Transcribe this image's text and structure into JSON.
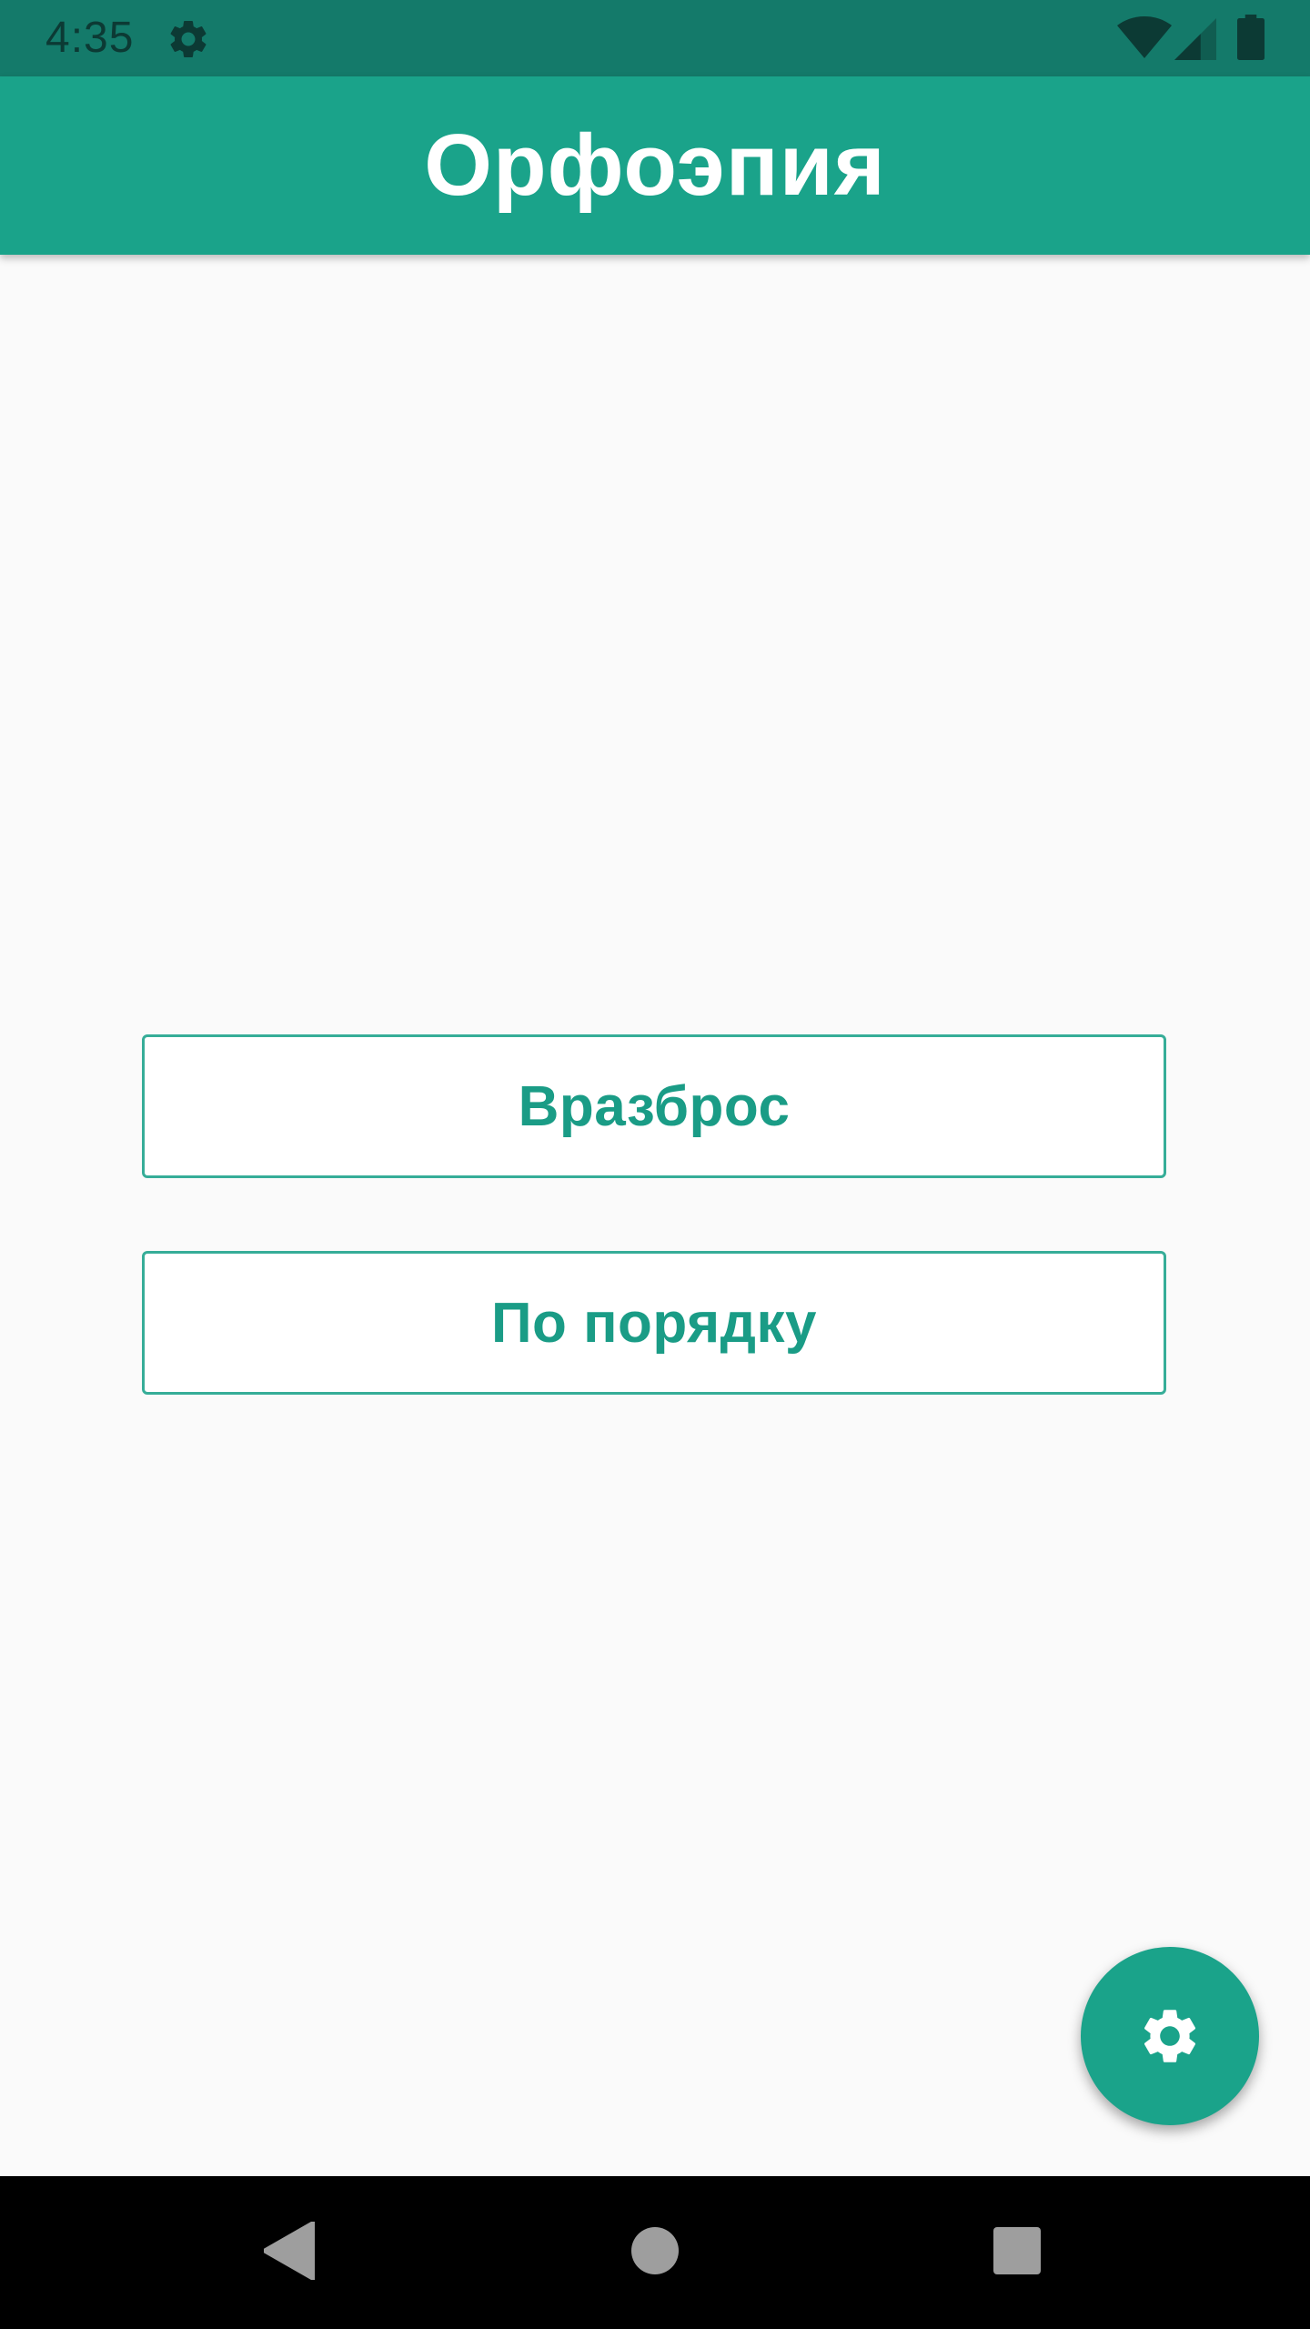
{
  "status_bar": {
    "time": "4:35",
    "icons": [
      "gear-icon",
      "wifi-icon",
      "signal-icon",
      "battery-icon"
    ]
  },
  "app_bar": {
    "title": "Орфоэпия"
  },
  "main": {
    "buttons": [
      {
        "label": "Вразброс"
      },
      {
        "label": "По порядку"
      }
    ]
  },
  "fab": {
    "icon": "gear-icon"
  },
  "nav_bar": {
    "icons": [
      "back-icon",
      "home-icon",
      "recents-icon"
    ]
  },
  "colors": {
    "status_bar": "#147a6a",
    "primary": "#1aa38a",
    "button_border": "#36ad98",
    "button_text": "#1a9c86",
    "background": "#fafafa",
    "nav_bar": "#000000"
  }
}
